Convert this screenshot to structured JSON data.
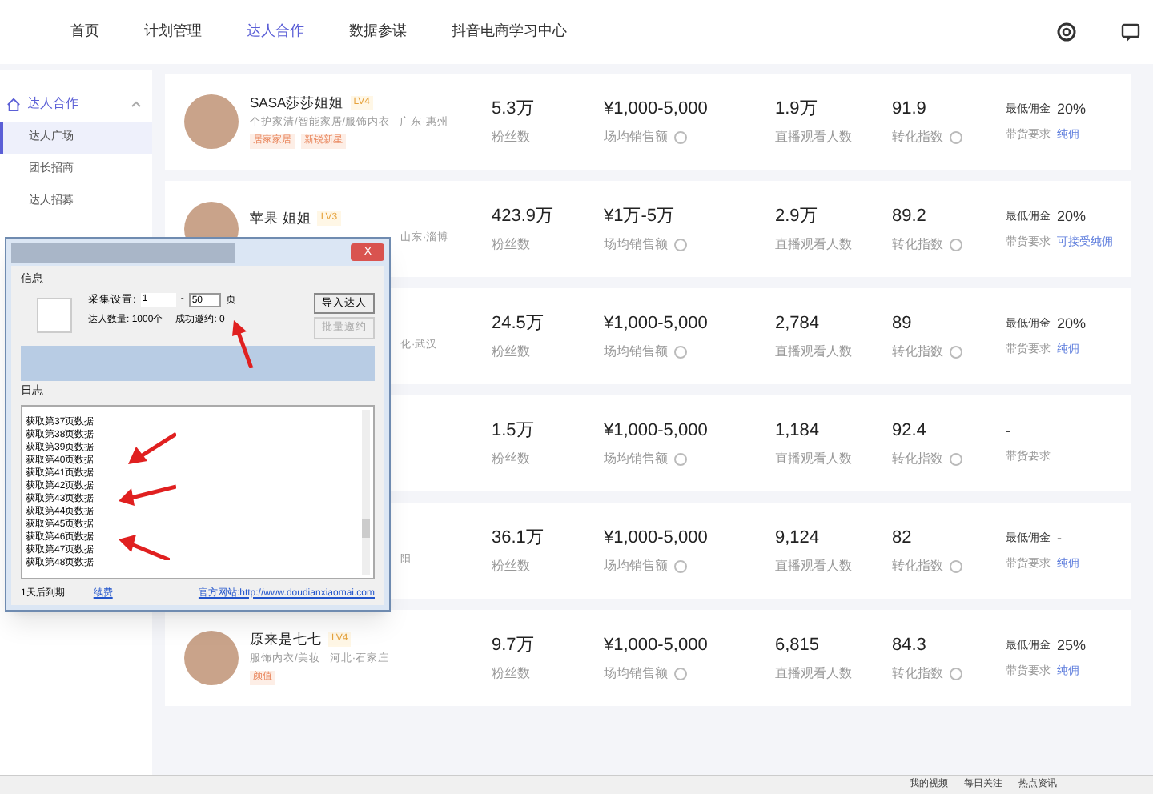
{
  "nav": {
    "items": [
      {
        "label": "首页",
        "selected": false
      },
      {
        "label": "计划管理",
        "selected": false
      },
      {
        "label": "达人合作",
        "selected": true
      },
      {
        "label": "数据参谋",
        "selected": false
      },
      {
        "label": "抖音电商学习中心",
        "selected": false
      }
    ]
  },
  "sidebar": {
    "group": "达人合作",
    "items": [
      {
        "label": "达人广场",
        "selected": true
      },
      {
        "label": "团长招商",
        "selected": false
      },
      {
        "label": "达人招募",
        "selected": false
      }
    ]
  },
  "rows": [
    {
      "name": "SASA莎莎姐姐",
      "level": "LV4",
      "category": "个护家清/智能家居/服饰内衣",
      "location": "广东·惠州",
      "tags": [
        "居家家居",
        "新锐新星"
      ],
      "fans": "5.3万",
      "fans_label": "粉丝数",
      "sales": "¥1,000-5,000",
      "sales_label": "场均销售额",
      "viewers": "1.9万",
      "viewers_label": "直播观看人数",
      "conversion": "91.9",
      "conversion_label": "转化指数",
      "commission_label": "最低佣金",
      "commission": "20%",
      "requirement_label": "带货要求",
      "requirement": "纯佣"
    },
    {
      "name": "苹果 姐姐",
      "level": "LV3",
      "category": "",
      "location": "山东·淄博",
      "tags": [],
      "fans": "423.9万",
      "fans_label": "粉丝数",
      "sales": "¥1万-5万",
      "sales_label": "场均销售额",
      "viewers": "2.9万",
      "viewers_label": "直播观看人数",
      "conversion": "89.2",
      "conversion_label": "转化指数",
      "commission_label": "最低佣金",
      "commission": "20%",
      "requirement_label": "带货要求",
      "requirement": "可接受纯佣"
    },
    {
      "name": "",
      "level": "",
      "category": "",
      "location": "化·武汉",
      "tags": [],
      "fans": "24.5万",
      "fans_label": "粉丝数",
      "sales": "¥1,000-5,000",
      "sales_label": "场均销售额",
      "viewers": "2,784",
      "viewers_label": "直播观看人数",
      "conversion": "89",
      "conversion_label": "转化指数",
      "commission_label": "最低佣金",
      "commission": "20%",
      "requirement_label": "带货要求",
      "requirement": "纯佣"
    },
    {
      "name": "",
      "level": "",
      "category": "",
      "location": "",
      "tags": [],
      "fans": "1.5万",
      "fans_label": "粉丝数",
      "sales": "¥1,000-5,000",
      "sales_label": "场均销售额",
      "viewers": "1,184",
      "viewers_label": "直播观看人数",
      "conversion": "92.4",
      "conversion_label": "转化指数",
      "commission_label": "",
      "commission": "-",
      "requirement_label": "带货要求",
      "requirement": ""
    },
    {
      "name": "",
      "level": "",
      "category": "",
      "location": "阳",
      "tags": [],
      "fans": "36.1万",
      "fans_label": "粉丝数",
      "sales": "¥1,000-5,000",
      "sales_label": "场均销售额",
      "viewers": "9,124",
      "viewers_label": "直播观看人数",
      "conversion": "82",
      "conversion_label": "转化指数",
      "commission_label": "最低佣金",
      "commission": "-",
      "requirement_label": "带货要求",
      "requirement": "纯佣"
    },
    {
      "name": "原来是七七",
      "level": "LV4",
      "category": "服饰内衣/美妆",
      "location": "河北·石家庄",
      "tags": [
        "颜值"
      ],
      "fans": "9.7万",
      "fans_label": "粉丝数",
      "sales": "¥1,000-5,000",
      "sales_label": "场均销售额",
      "viewers": "6,815",
      "viewers_label": "直播观看人数",
      "conversion": "84.3",
      "conversion_label": "转化指数",
      "commission_label": "最低佣金",
      "commission": "25%",
      "requirement_label": "带货要求",
      "requirement": "纯佣"
    }
  ],
  "dialog": {
    "close": "X",
    "info_title": "信息",
    "range_label": "采集设置:",
    "range_from": "1",
    "range_dash": "-",
    "range_to": "50",
    "range_unit": "页",
    "import_button": "导入达人",
    "invite_button": {
      "label": "批量邀约",
      "disabled": true
    },
    "count_label": "达人数量: 1000个",
    "success_label": "成功邀约: 0",
    "log_title": "日志",
    "log": [
      "获取第37页数据",
      "获取第38页数据",
      "获取第39页数据",
      "获取第40页数据",
      "获取第41页数据",
      "获取第42页数据",
      "获取第43页数据",
      "获取第44页数据",
      "获取第45页数据",
      "获取第46页数据",
      "获取第47页数据",
      "获取第48页数据"
    ],
    "expiry": "1天后到期",
    "renew": "续费",
    "website": "官方网站:http://www.doudianxiaomai.com"
  },
  "taskbar": [
    "我的视频",
    "每日关注",
    "热点资讯"
  ]
}
